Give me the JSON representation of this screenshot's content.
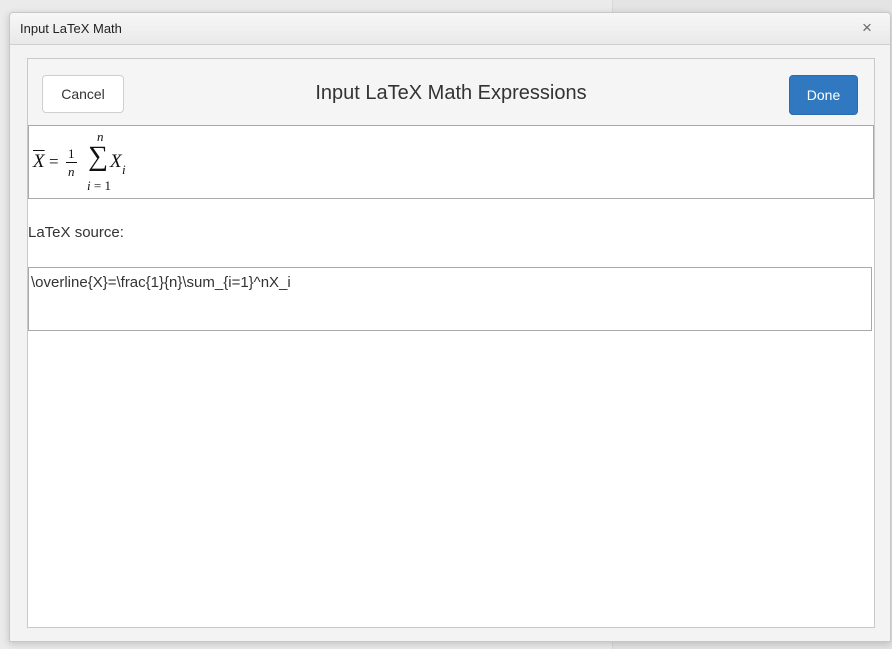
{
  "dialog": {
    "title": "Input LaTeX Math",
    "close_label": "×"
  },
  "header": {
    "cancel_label": "Cancel",
    "title": "Input LaTeX Math Expressions",
    "done_label": "Done"
  },
  "preview": {
    "rendered": {
      "lhs": "X",
      "equals": "=",
      "frac_numerator": "1",
      "frac_denominator": "n",
      "sum_upper": "n",
      "sum_symbol": "∑",
      "sum_lower_var": "i",
      "sum_lower_rest": " = 1",
      "term": "X",
      "term_subscript": "i"
    }
  },
  "source": {
    "label": "LaTeX source:",
    "value": "\\overline{X}=\\frac{1}{n}\\sum_{i=1}^nX_i"
  },
  "colors": {
    "done_button": "#3079c0",
    "dialog_background": "#f3f3f3"
  }
}
